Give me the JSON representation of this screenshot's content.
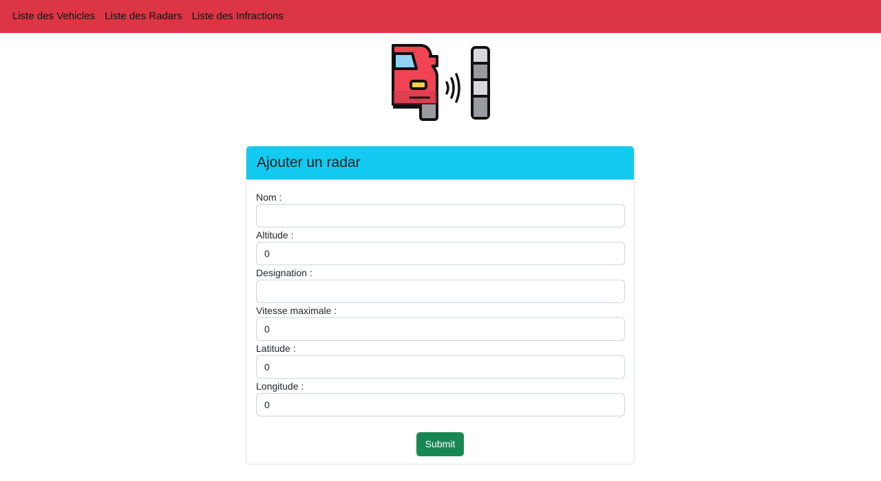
{
  "nav": {
    "items": [
      {
        "label": "Liste des Vehicles"
      },
      {
        "label": "Liste des Radars"
      },
      {
        "label": "Liste des Infractions"
      }
    ],
    "background": "#dc3545"
  },
  "logo": {
    "icon": "radar-car-icon"
  },
  "form": {
    "title": "Ajouter un radar",
    "header_color": "#13caf0",
    "fields": [
      {
        "label": "Nom :",
        "value": ""
      },
      {
        "label": "Altitude :",
        "value": "0"
      },
      {
        "label": "Designation :",
        "value": ""
      },
      {
        "label": "Vitesse maximale :",
        "value": "0"
      },
      {
        "label": "Latitude :",
        "value": "0"
      },
      {
        "label": "Longitude :",
        "value": "0"
      }
    ],
    "submit_label": "Submit",
    "submit_color": "#198754"
  }
}
